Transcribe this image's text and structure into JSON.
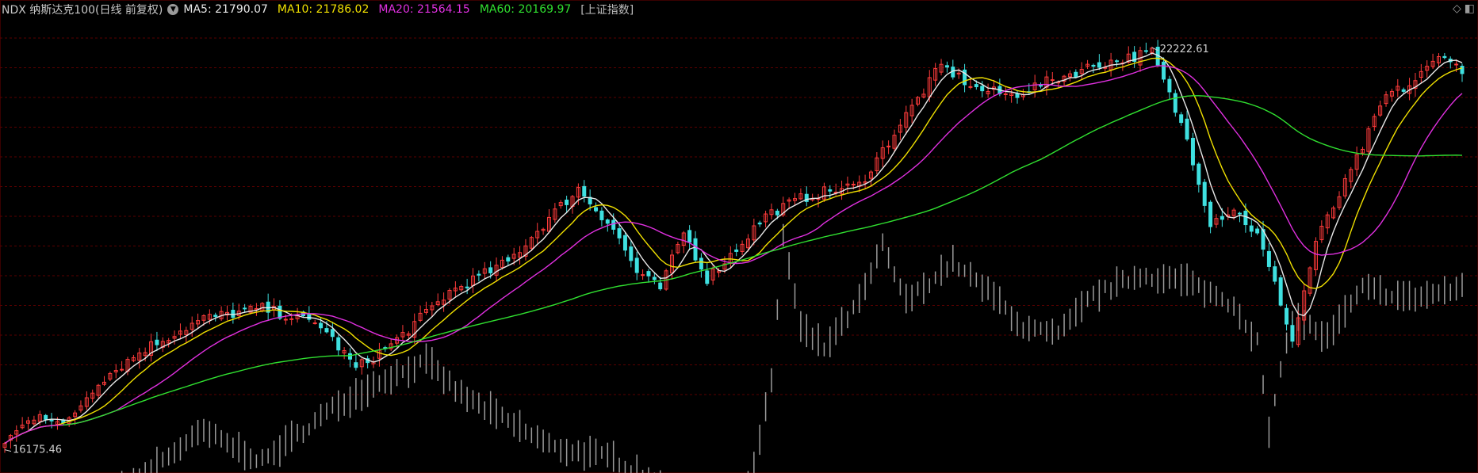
{
  "header": {
    "symbol": "NDX 纳斯达克100(日线 前复权)",
    "dropdown_icon": "chevron-down-icon",
    "ma5": "MA5: 21790.07",
    "ma10": "MA10: 21786.02",
    "ma20": "MA20: 21564.15",
    "ma60": "MA60: 20169.97",
    "reference": "[上证指数]",
    "icons": [
      "diamond-icon",
      "window-icon"
    ]
  },
  "colors": {
    "background": "#000000",
    "grid": "#5a0000",
    "up": "#ff3b3b",
    "down": "#3fe0e0",
    "ma5": "#e8e8e8",
    "ma10": "#f0e000",
    "ma20": "#e030e0",
    "ma60": "#30e030",
    "overlay": "#9a9a9a"
  },
  "chart_data": {
    "type": "line",
    "subtype": "candlestick-with-moving-averages",
    "title": "NDX 纳斯达克100(日线 前复权)",
    "annotations": [
      {
        "text": "22222.61",
        "label": "high",
        "x_index": 196,
        "value": 22222.61
      },
      {
        "text": "16175.46",
        "label": "low",
        "x_index": 0,
        "value": 16175.46
      }
    ],
    "grid": true,
    "ylim": [
      15850,
      22650
    ],
    "count": 250,
    "price_keyframes": [
      [
        0,
        16300
      ],
      [
        6,
        16750
      ],
      [
        10,
        16520
      ],
      [
        16,
        17200
      ],
      [
        24,
        17700
      ],
      [
        34,
        18150
      ],
      [
        44,
        18300
      ],
      [
        54,
        18050
      ],
      [
        60,
        17400
      ],
      [
        66,
        17750
      ],
      [
        76,
        18550
      ],
      [
        86,
        19000
      ],
      [
        94,
        19750
      ],
      [
        98,
        20100
      ],
      [
        104,
        19500
      ],
      [
        108,
        18850
      ],
      [
        112,
        18600
      ],
      [
        116,
        19450
      ],
      [
        120,
        18750
      ],
      [
        124,
        19100
      ],
      [
        130,
        19700
      ],
      [
        136,
        19950
      ],
      [
        140,
        20050
      ],
      [
        146,
        20150
      ],
      [
        154,
        21200
      ],
      [
        160,
        21950
      ],
      [
        166,
        21600
      ],
      [
        172,
        21500
      ],
      [
        178,
        21700
      ],
      [
        186,
        21950
      ],
      [
        196,
        22150
      ],
      [
        202,
        20850
      ],
      [
        206,
        19600
      ],
      [
        210,
        19800
      ],
      [
        214,
        19400
      ],
      [
        218,
        18400
      ],
      [
        220,
        17800
      ],
      [
        224,
        19300
      ],
      [
        230,
        20350
      ],
      [
        236,
        21500
      ],
      [
        240,
        21650
      ],
      [
        246,
        22150
      ],
      [
        249,
        21820
      ]
    ],
    "overlay_keyframes": [
      [
        0,
        14600
      ],
      [
        6,
        14000
      ],
      [
        10,
        14500
      ],
      [
        16,
        14300
      ],
      [
        20,
        15600
      ],
      [
        34,
        16450
      ],
      [
        44,
        16000
      ],
      [
        56,
        16800
      ],
      [
        64,
        17200
      ],
      [
        72,
        17500
      ],
      [
        78,
        17000
      ],
      [
        86,
        16600
      ],
      [
        94,
        16200
      ],
      [
        104,
        16050
      ],
      [
        112,
        15650
      ],
      [
        120,
        15100
      ],
      [
        124,
        14900
      ],
      [
        128,
        15900
      ],
      [
        131,
        17200
      ],
      [
        133,
        19400
      ],
      [
        136,
        18000
      ],
      [
        140,
        17700
      ],
      [
        146,
        18400
      ],
      [
        150,
        19250
      ],
      [
        154,
        18400
      ],
      [
        162,
        19000
      ],
      [
        170,
        18400
      ],
      [
        174,
        18000
      ],
      [
        180,
        17900
      ],
      [
        186,
        18500
      ],
      [
        194,
        18800
      ],
      [
        202,
        18700
      ],
      [
        210,
        18350
      ],
      [
        214,
        17800
      ],
      [
        216,
        16450
      ],
      [
        220,
        18200
      ],
      [
        226,
        17850
      ],
      [
        232,
        18600
      ],
      [
        240,
        18450
      ],
      [
        249,
        18600
      ]
    ]
  }
}
